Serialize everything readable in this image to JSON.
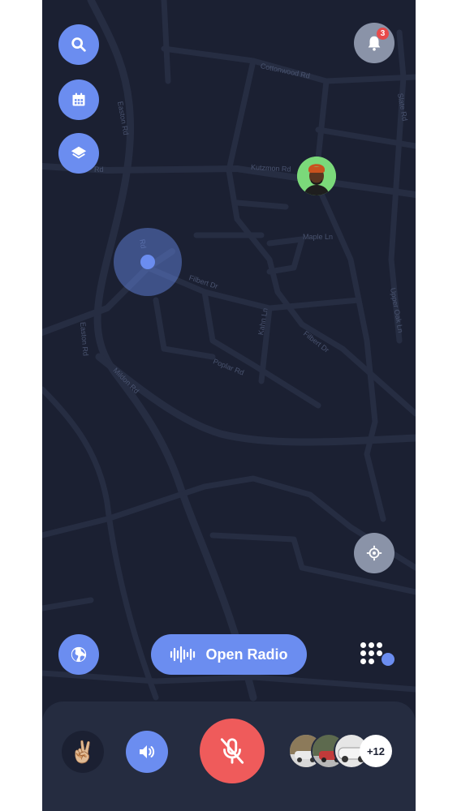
{
  "map": {
    "streets": [
      "Cottonwood Rd",
      "Slate Rd",
      "Easton Rd",
      "Kutzmon Rd",
      "Rd",
      "Maple Ln",
      "Filbert Dr",
      "Upper Oak Ln",
      "Easton Rd",
      "Kahn Ln",
      "Filbert Dr",
      "Poplar Rd",
      "Mildon Rd",
      "Rd"
    ]
  },
  "notifications": {
    "count": "3",
    "icon": "bell-icon"
  },
  "toolbar": {
    "search_icon": "search-icon",
    "calendar_icon": "calendar-icon",
    "layers_icon": "layers-icon",
    "globe_icon": "globe-icon",
    "locate_icon": "crosshair-icon"
  },
  "radio": {
    "label": "Open Radio",
    "icon": "audio-wave-icon"
  },
  "bottom_bar": {
    "reaction": "✌🏼",
    "speaker_icon": "speaker-icon",
    "mic_icon": "mic-off-icon",
    "participants_more": "+12"
  },
  "colors": {
    "background": "#1b2032",
    "accent": "#6b8df0",
    "mute": "#ef5b5b",
    "pin": "#7bd97a",
    "badge": "#e84a4a"
  }
}
